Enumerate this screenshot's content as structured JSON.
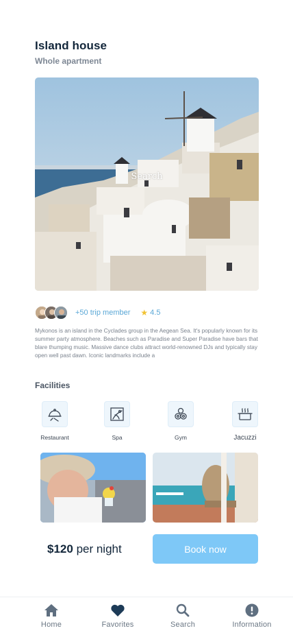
{
  "header": {
    "title": "Island house",
    "subtitle": "Whole apartment"
  },
  "hero": {
    "overlay_text": "Search"
  },
  "members": {
    "count_text": "+50 trip member",
    "rating": "4.5"
  },
  "description": "Mykonos is an island in the Cyclades group in the Aegean Sea. It's popularly known for its summer party atmosphere. Beaches such as Paradise and Super Paradise have bars that blare thumping music. Massive dance clubs attract world-renowned DJs and typically stay open well past dawn. Iconic landmarks include a",
  "facilities": {
    "heading": "Facilities",
    "items": [
      {
        "label": "Restaurant",
        "icon": "cloche-icon"
      },
      {
        "label": "Spa",
        "icon": "spa-icon"
      },
      {
        "label": "Gym",
        "icon": "dumbbell-icon"
      },
      {
        "label": "Jacuzzi",
        "icon": "hot-tub-icon"
      }
    ]
  },
  "booking": {
    "price": "$120",
    "per": "per night",
    "button": "Book now"
  },
  "nav": {
    "items": [
      {
        "label": "Home",
        "icon": "home-icon"
      },
      {
        "label": "Favorites",
        "icon": "heart-icon"
      },
      {
        "label": "Search",
        "icon": "search-icon"
      },
      {
        "label": "Information",
        "icon": "info-icon"
      }
    ]
  },
  "colors": {
    "accent": "#7ec8f7",
    "link": "#5aa7d6",
    "nav_icon": "#5f6f80",
    "title": "#12263a"
  }
}
